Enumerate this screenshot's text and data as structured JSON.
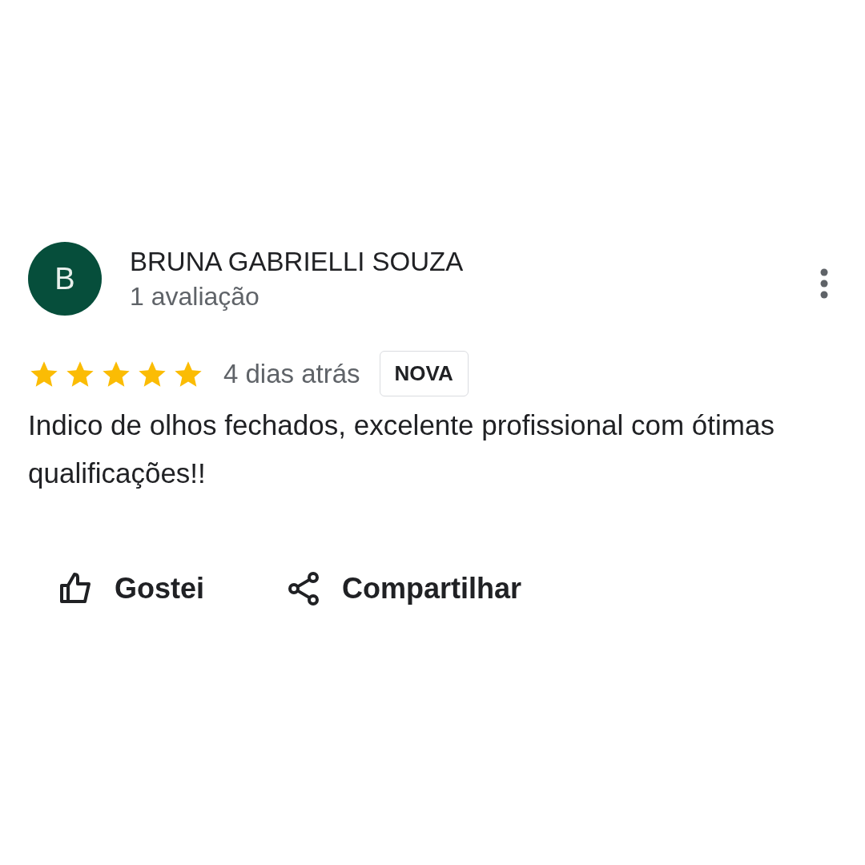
{
  "review": {
    "avatar_letter": "B",
    "author": "BRUNA GABRIELLI SOUZA",
    "author_meta": "1 avaliação",
    "stars": 5,
    "date": "4 dias atrás",
    "badge": "NOVA",
    "text": "Indico de olhos fechados, excelente profissional com ótimas qualificações!!"
  },
  "actions": [
    {
      "kind": "like",
      "label": "Gostei"
    },
    {
      "kind": "share",
      "label": "Compartilhar"
    }
  ]
}
